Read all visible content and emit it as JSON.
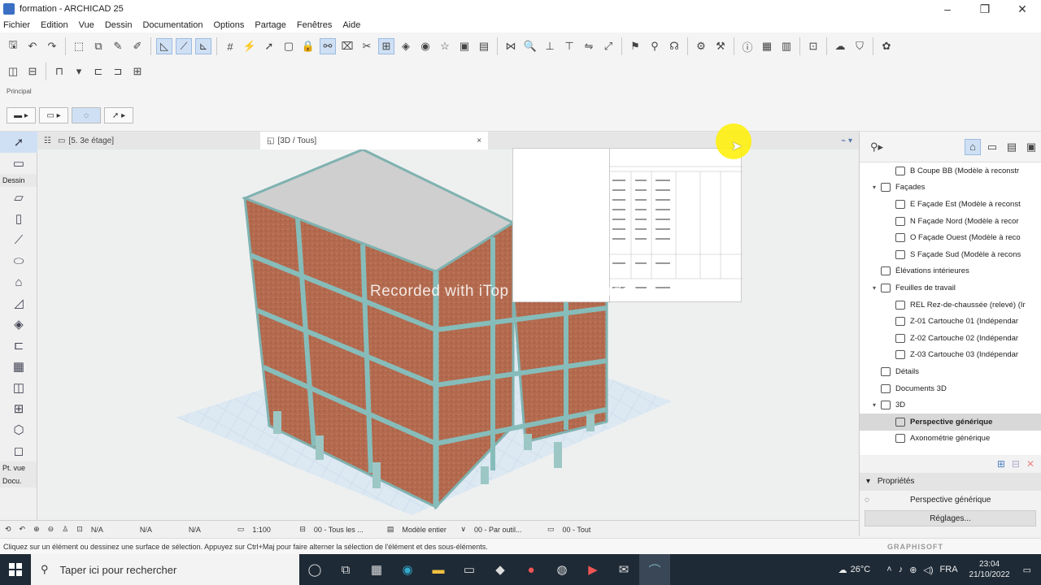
{
  "window": {
    "title": "formation - ARCHICAD 25",
    "min": "–",
    "max": "❐",
    "close": "✕"
  },
  "menu": [
    "Fichier",
    "Edition",
    "Vue",
    "Dessin",
    "Documentation",
    "Options",
    "Partage",
    "Fenêtres",
    "Aide"
  ],
  "infobox": {
    "label": "Principal"
  },
  "toolbox": {
    "sections": {
      "dessin": "Dessin",
      "ptvue": "Pt. vue",
      "docu": "Docu."
    }
  },
  "tabs": {
    "floorplan": "[5. 3e étage]",
    "view3d": "[3D / Tous]",
    "close": "×"
  },
  "viewport": {
    "watermark": "Recorded with iTop Screen Recorder"
  },
  "navigator": {
    "items": [
      {
        "label": "B Coupe BB (Modèle à reconstr",
        "level": 2,
        "arrow": "",
        "selected": false
      },
      {
        "label": "Façades",
        "level": 1,
        "arrow": "▾",
        "selected": false
      },
      {
        "label": "E Façade Est (Modèle à reconst",
        "level": 2,
        "arrow": "",
        "selected": false
      },
      {
        "label": "N Façade Nord (Modèle à recor",
        "level": 2,
        "arrow": "",
        "selected": false
      },
      {
        "label": "O Façade Ouest (Modèle à reco",
        "level": 2,
        "arrow": "",
        "selected": false
      },
      {
        "label": "S Façade Sud (Modèle à recons",
        "level": 2,
        "arrow": "",
        "selected": false
      },
      {
        "label": "Élévations intérieures",
        "level": 1,
        "arrow": "",
        "selected": false
      },
      {
        "label": "Feuilles de travail",
        "level": 1,
        "arrow": "▾",
        "selected": false
      },
      {
        "label": "REL Rez-de-chaussée (relevé) (Ir",
        "level": 2,
        "arrow": "",
        "selected": false
      },
      {
        "label": "Z-01 Cartouche 01 (Indépendar",
        "level": 2,
        "arrow": "",
        "selected": false
      },
      {
        "label": "Z-02 Cartouche 02 (Indépendar",
        "level": 2,
        "arrow": "",
        "selected": false
      },
      {
        "label": "Z-03 Cartouche 03 (Indépendar",
        "level": 2,
        "arrow": "",
        "selected": false
      },
      {
        "label": "Détails",
        "level": 1,
        "arrow": "",
        "selected": false
      },
      {
        "label": "Documents 3D",
        "level": 1,
        "arrow": "",
        "selected": false
      },
      {
        "label": "3D",
        "level": 1,
        "arrow": "▾",
        "selected": false
      },
      {
        "label": "Perspective générique",
        "level": 2,
        "arrow": "",
        "selected": true
      },
      {
        "label": "Axonométrie générique",
        "level": 2,
        "arrow": "",
        "selected": false
      }
    ]
  },
  "properties": {
    "header": "Propriétés",
    "value": "Perspective générique",
    "button": "Réglages..."
  },
  "statusnav": {
    "zoom1": "N/A",
    "zoom2": "N/A",
    "zoom3": "N/A",
    "scale": "1:100",
    "layers": "00 - Tous les ...",
    "model": "Modèle entier",
    "pens": "00 - Par outil...",
    "dims": "00 - Tout"
  },
  "help": {
    "text": "Cliquez sur un élément ou dessinez une surface de sélection. Appuyez sur Ctrl+Maj pour faire alterner la sélection de l'élément et des sous-éléments.",
    "brand": "GRAPHISOFT"
  },
  "taskbar": {
    "search_placeholder": "Taper ici pour rechercher",
    "weather": "26°C",
    "lang": "FRA",
    "time": "23:04",
    "date": "21/10/2022"
  }
}
